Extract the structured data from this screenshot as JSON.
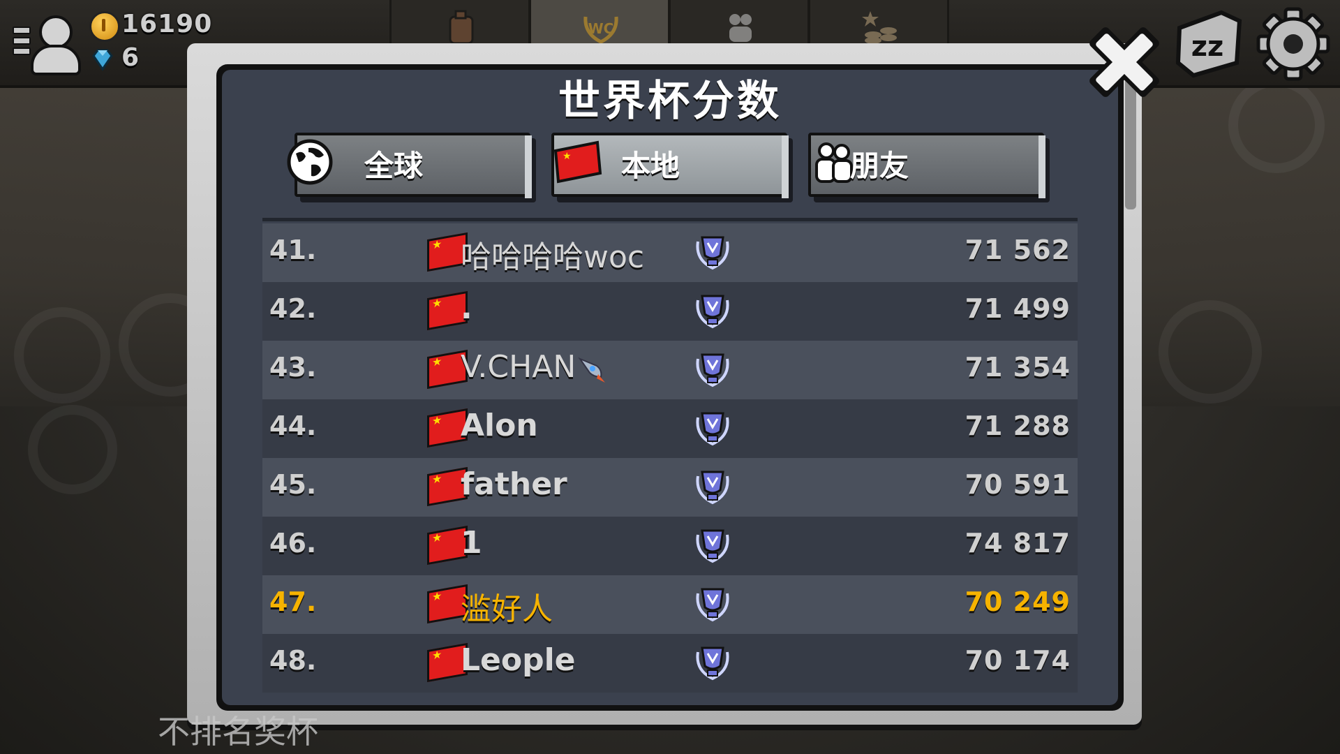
{
  "resources": {
    "coins": "16190",
    "gems": "6"
  },
  "top_tabs": [
    {
      "icon": "fuel-can-icon",
      "active": false
    },
    {
      "icon": "world-cup-icon",
      "active": true
    },
    {
      "icon": "vs-players-icon",
      "active": false
    },
    {
      "icon": "trophies-coins-icon",
      "active": false
    }
  ],
  "panel": {
    "title": "世界杯分数",
    "tabs": [
      {
        "label": "全球",
        "icon": "globe-icon",
        "active": false
      },
      {
        "label": "本地",
        "icon": "china-flag-icon",
        "active": true
      },
      {
        "label": "朋友",
        "icon": "friends-icon",
        "active": false
      }
    ]
  },
  "leaderboard": [
    {
      "rank": "41.",
      "name": "哈哈哈哈woc",
      "score": "71 562",
      "bold": false,
      "me": false,
      "emoji": ""
    },
    {
      "rank": "42.",
      "name": ".",
      "score": "71 499",
      "bold": true,
      "me": false,
      "emoji": ""
    },
    {
      "rank": "43.",
      "name": "V.CHAN",
      "score": "71 354",
      "bold": false,
      "me": false,
      "emoji": "rocket-icon"
    },
    {
      "rank": "44.",
      "name": "Alon",
      "score": "71 288",
      "bold": true,
      "me": false,
      "emoji": ""
    },
    {
      "rank": "45.",
      "name": "father",
      "score": "70 591",
      "bold": true,
      "me": false,
      "emoji": ""
    },
    {
      "rank": "46.",
      "name": "1",
      "score": "74 817",
      "bold": true,
      "me": false,
      "emoji": ""
    },
    {
      "rank": "47.",
      "name": "滥好人",
      "score": "70 249",
      "bold": false,
      "me": true,
      "emoji": ""
    },
    {
      "rank": "48.",
      "name": "Leople",
      "score": "70 174",
      "bold": true,
      "me": false,
      "emoji": ""
    }
  ],
  "footer": "不排名奖杯",
  "colors": {
    "highlight": "#f6b300",
    "row_light": "#4a505c",
    "row_dark": "#363b46",
    "panel": "#3b414e"
  }
}
